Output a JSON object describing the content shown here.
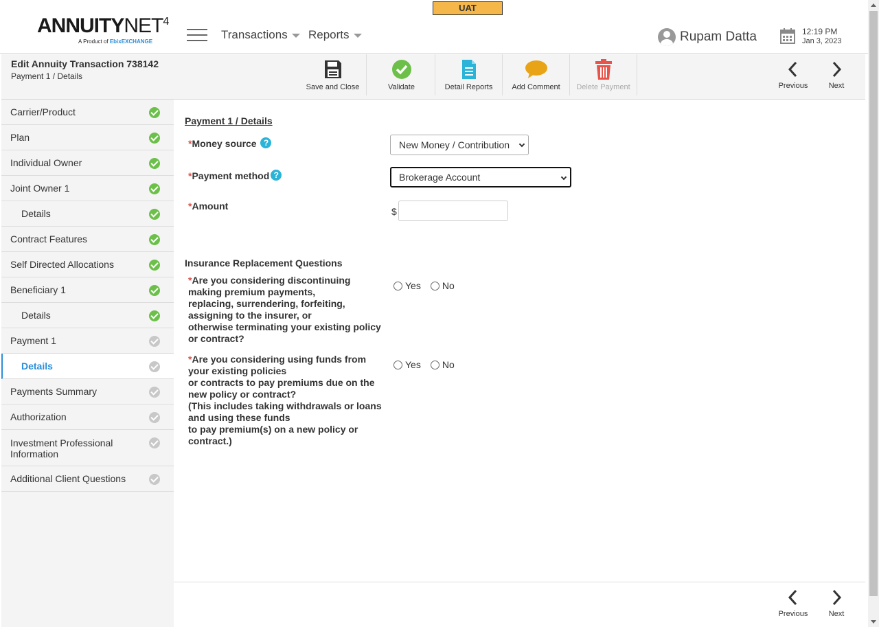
{
  "header": {
    "logo_main_a": "Annuity",
    "logo_main_b": "Net",
    "logo_main_sup": "4",
    "logo_sub": "A Product of",
    "logo_brand": "EbixEXCHANGE",
    "env_badge": "UAT",
    "menu_transactions": "Transactions",
    "menu_reports": "Reports",
    "user_name": "Rupam Datta",
    "time": "12:19 PM",
    "date": "Jan 3, 2023"
  },
  "toolbar": {
    "title": "Edit Annuity Transaction 738142",
    "subtitle": "Payment 1 / Details",
    "save_close": "Save and Close",
    "validate": "Validate",
    "detail_reports": "Detail Reports",
    "add_comment": "Add Comment",
    "delete_payment": "Delete Payment",
    "previous": "Previous",
    "next": "Next"
  },
  "sidebar": {
    "items": [
      {
        "label": "Carrier/Product",
        "status": "done"
      },
      {
        "label": "Plan",
        "status": "done"
      },
      {
        "label": "Individual Owner",
        "status": "done"
      },
      {
        "label": "Joint Owner 1",
        "status": "done"
      },
      {
        "label": "Details",
        "status": "done"
      },
      {
        "label": "Contract Features",
        "status": "done"
      },
      {
        "label": "Self Directed Allocations",
        "status": "done"
      },
      {
        "label": "Beneficiary 1",
        "status": "done"
      },
      {
        "label": "Details",
        "status": "done"
      },
      {
        "label": "Payment 1",
        "status": "todo"
      },
      {
        "label": "Details",
        "status": "todo"
      },
      {
        "label": "Payments Summary",
        "status": "todo"
      },
      {
        "label": "Authorization",
        "status": "todo"
      },
      {
        "label": "Investment Professional Information",
        "status": "todo"
      },
      {
        "label": "Additional Client Questions",
        "status": "todo"
      }
    ]
  },
  "form": {
    "section_title": "Payment 1 / Details",
    "required_mark": "*",
    "money_source_label": "Money source",
    "money_source_value": "New Money / Contribution",
    "payment_method_label": "Payment method",
    "payment_method_value": "Brokerage Account",
    "amount_label": "Amount",
    "currency_symbol": "$",
    "amount_value": "",
    "help_glyph": "?",
    "irq_title": "Insurance Replacement Questions",
    "q1_lines": [
      "Are you considering discontinuing making premium payments,",
      "replacing, surrendering, forfeiting, assigning to the insurer, or",
      "otherwise terminating your existing policy or contract?"
    ],
    "q2_lines": [
      "Are you considering using funds from your existing policies",
      "or contracts to pay premiums due on the new policy or contract?",
      "(This includes taking withdrawals or loans and using these funds",
      "to pay premium(s) on a new policy or contract.)"
    ],
    "yes": "Yes",
    "no": "No"
  },
  "colors": {
    "accent": "#2b8ed8",
    "done": "#6cc04a",
    "todo": "#c8c8c8",
    "uat": "#f5b74a",
    "delete": "#e8534a",
    "comment": "#e8a317",
    "report": "#2bb3d8"
  }
}
